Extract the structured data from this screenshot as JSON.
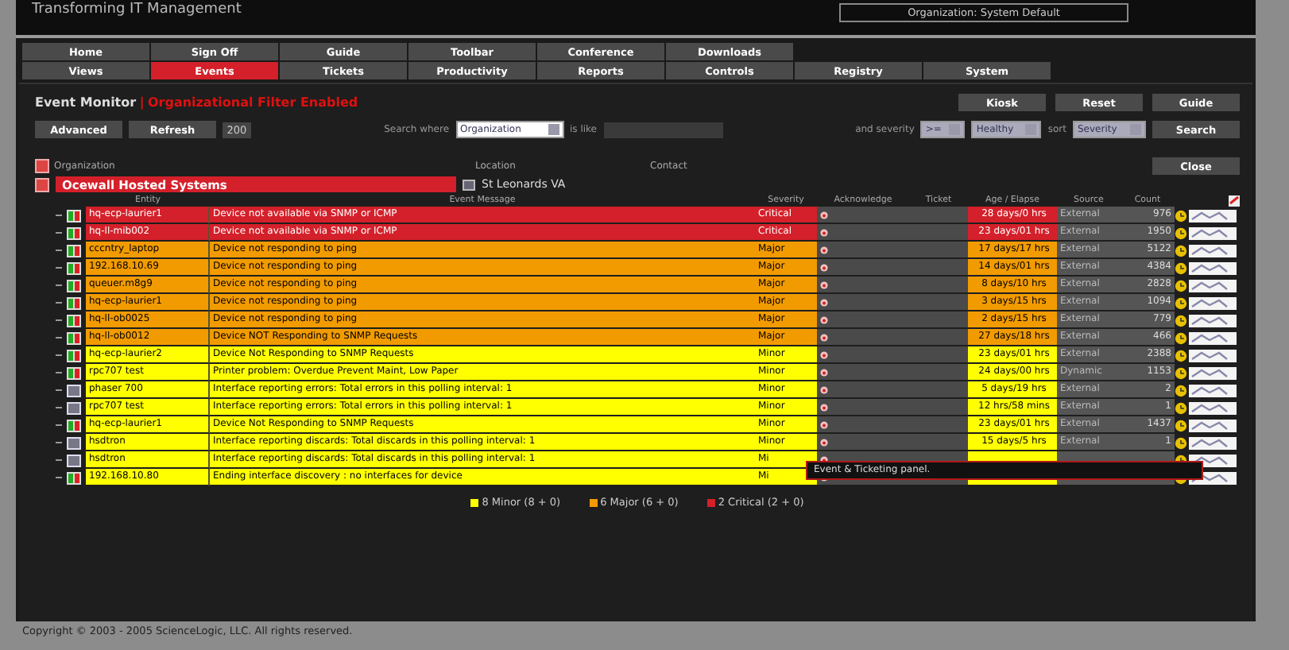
{
  "header": {
    "title": "Transforming IT Management",
    "organization": "Organization: System Default"
  },
  "nav": {
    "rows": [
      [
        {
          "label": "Home",
          "selected": false
        },
        {
          "label": "Sign Off",
          "selected": false
        },
        {
          "label": "Guide",
          "selected": false
        },
        {
          "label": "Toolbar",
          "selected": false
        },
        {
          "label": "Conference",
          "selected": false
        },
        {
          "label": "Downloads",
          "selected": false
        }
      ],
      [
        {
          "label": "Views",
          "selected": false
        },
        {
          "label": "Events",
          "selected": true
        },
        {
          "label": "Tickets",
          "selected": false
        },
        {
          "label": "Productivity",
          "selected": false
        },
        {
          "label": "Reports",
          "selected": false
        },
        {
          "label": "Controls",
          "selected": false
        },
        {
          "label": "Registry",
          "selected": false
        },
        {
          "label": "System",
          "selected": false
        }
      ]
    ]
  },
  "monitor": {
    "title": "Event Monitor",
    "separator": "|",
    "filter": "Organizational Filter Enabled",
    "buttons": [
      "Kiosk",
      "Reset",
      "Guide"
    ],
    "left_buttons": [
      "Advanced",
      "Refresh"
    ],
    "limit": "200",
    "search": {
      "where_label": "Search where",
      "field": "Organization",
      "like_label": "is like",
      "severity_label": "and severity",
      "operator": ">=",
      "severity": "Healthy",
      "sort_label": "sort",
      "sort": "Severity",
      "button": "Search"
    }
  },
  "organization": {
    "columns": [
      "Organization",
      "Location",
      "Contact"
    ],
    "close": "Close",
    "name": "Ocewall Hosted Systems",
    "location": "St Leonards VA"
  },
  "table": {
    "columns": [
      "Entity",
      "Event Message",
      "Severity",
      "Acknowledge",
      "Ticket",
      "Age / Elapse",
      "Source",
      "Count"
    ],
    "rows": [
      {
        "color": "#d4202a",
        "kind": "status",
        "entity": "hq-ecp-laurier1",
        "message": "Device not available via SNMP or ICMP",
        "severity": "Critical",
        "age": "28 days/0 hrs",
        "source": "External",
        "count": "976"
      },
      {
        "color": "#d4202a",
        "kind": "status",
        "entity": "hq-ll-mib002",
        "message": "Device not available via SNMP or ICMP",
        "severity": "Critical",
        "age": "23 days/01 hrs",
        "source": "External",
        "count": "1950"
      },
      {
        "color": "#f29b00",
        "kind": "status",
        "entity": "cccntry_laptop",
        "message": "Device not responding to ping",
        "severity": "Major",
        "age": "17 days/17 hrs",
        "source": "External",
        "count": "5122"
      },
      {
        "color": "#f29b00",
        "kind": "status",
        "entity": "192.168.10.69",
        "message": "Device not responding to ping",
        "severity": "Major",
        "age": "14 days/01 hrs",
        "source": "External",
        "count": "4384"
      },
      {
        "color": "#f29b00",
        "kind": "status",
        "entity": "queuer.m8g9",
        "message": "Device not responding to ping",
        "severity": "Major",
        "age": "8 days/10 hrs",
        "source": "External",
        "count": "2828"
      },
      {
        "color": "#f29b00",
        "kind": "status",
        "entity": "hq-ecp-laurier1",
        "message": "Device not responding to ping",
        "severity": "Major",
        "age": "3 days/15 hrs",
        "source": "External",
        "count": "1094"
      },
      {
        "color": "#f29b00",
        "kind": "status",
        "entity": "hq-ll-ob0025",
        "message": "Device not responding to ping",
        "severity": "Major",
        "age": "2 days/15 hrs",
        "source": "External",
        "count": "779"
      },
      {
        "color": "#f29b00",
        "kind": "status",
        "entity": "hq-ll-ob0012",
        "message": "Device NOT Responding to SNMP Requests",
        "severity": "Major",
        "age": "27 days/18 hrs",
        "source": "External",
        "count": "466"
      },
      {
        "color": "#ffff00",
        "kind": "status",
        "entity": "hq-ecp-laurier2",
        "message": "Device Not Responding to SNMP Requests",
        "severity": "Minor",
        "age": "23 days/01 hrs",
        "source": "External",
        "count": "2388"
      },
      {
        "color": "#ffff00",
        "kind": "status",
        "entity": "rpc707 test",
        "message": "Printer problem: Overdue Prevent Maint, Low Paper",
        "severity": "Minor",
        "age": "24 days/00 hrs",
        "source": "Dynamic",
        "count": "1153"
      },
      {
        "color": "#ffff00",
        "kind": "plain",
        "entity": "phaser 700",
        "message": "Interface reporting errors: Total errors in this polling interval: 1",
        "severity": "Minor",
        "age": "5 days/19 hrs",
        "source": "External",
        "count": "2"
      },
      {
        "color": "#ffff00",
        "kind": "plain",
        "entity": "rpc707 test",
        "message": "Interface reporting errors: Total errors in this polling interval: 1",
        "severity": "Minor",
        "age": "12 hrs/58 mins",
        "source": "External",
        "count": "1"
      },
      {
        "color": "#ffff00",
        "kind": "status",
        "entity": "hq-ecp-laurier1",
        "message": "Device Not Responding to SNMP Requests",
        "severity": "Minor",
        "age": "23 days/01 hrs",
        "source": "External",
        "count": "1437"
      },
      {
        "color": "#ffff00",
        "kind": "plain",
        "entity": "hsdtron",
        "message": "Interface reporting discards: Total discards in this polling interval: 1",
        "severity": "Minor",
        "age": "15 days/5 hrs",
        "source": "External",
        "count": "1"
      },
      {
        "color": "#ffff00",
        "kind": "plain",
        "entity": "hsdtron",
        "message": "Interface reporting discards: Total discards in this polling interval: 1",
        "severity": "Mi"
      },
      {
        "color": "#ffff00",
        "kind": "status",
        "entity": "192.168.10.80",
        "message": "Ending interface discovery : no interfaces for device",
        "severity": "Mi"
      }
    ]
  },
  "tooltip": "Event & Ticketing panel.",
  "legend": [
    {
      "label": "8 Minor (8 + 0)",
      "color": "#ffff00"
    },
    {
      "label": "6 Major (6 + 0)",
      "color": "#f29b00"
    },
    {
      "label": "2 Critical (2 + 0)",
      "color": "#d4202a"
    }
  ],
  "footer": "Copyright © 2003 - 2005 ScienceLogic, LLC. All rights reserved."
}
